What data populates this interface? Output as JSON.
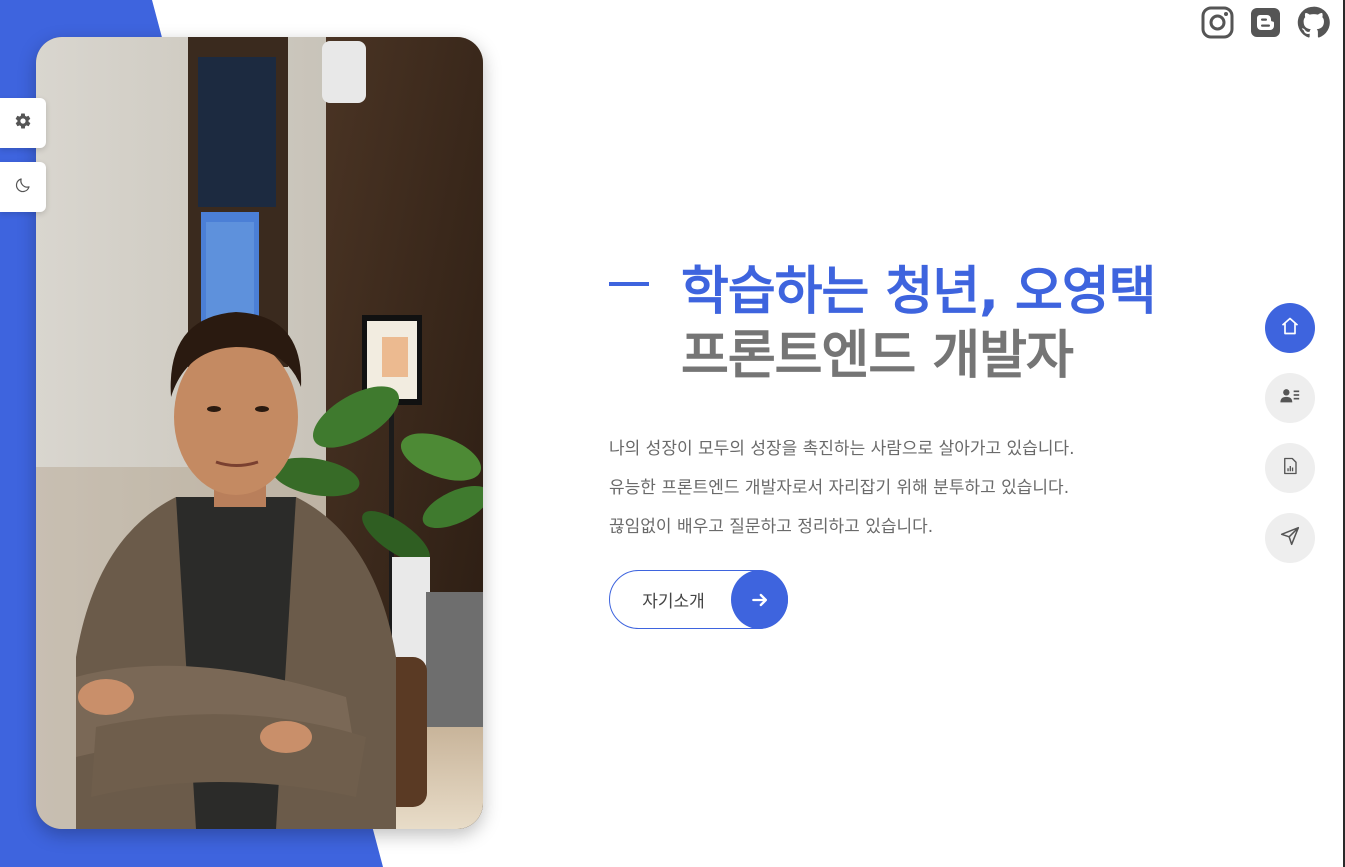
{
  "colors": {
    "accent": "#3e64de",
    "title_secondary": "#757575",
    "body_text": "#6a6a6a",
    "nav_inactive_bg": "#eeeeee"
  },
  "sidebar": {
    "settings_icon": "gear-icon",
    "theme_icon": "moon-icon"
  },
  "social": {
    "items": [
      {
        "name": "instagram",
        "icon": "instagram-icon"
      },
      {
        "name": "blogger",
        "icon": "blogger-icon"
      },
      {
        "name": "github",
        "icon": "github-icon"
      }
    ]
  },
  "hero": {
    "title_line1": "학습하는 청년, 오영택",
    "title_line2": "프론트엔드 개발자",
    "description": [
      "나의 성장이 모두의 성장을 촉진하는 사람으로 살아가고 있습니다.",
      "유능한 프론트엔드 개발자로서 자리잡기 위해 분투하고 있습니다.",
      "끊임없이 배우고 질문하고 정리하고 있습니다."
    ],
    "cta_label": "자기소개",
    "cta_icon": "arrow-right-icon"
  },
  "nav": {
    "items": [
      {
        "icon": "home-icon",
        "active": true
      },
      {
        "icon": "profile-card-icon",
        "active": false
      },
      {
        "icon": "resume-file-icon",
        "active": false
      },
      {
        "icon": "send-icon",
        "active": false
      }
    ]
  }
}
